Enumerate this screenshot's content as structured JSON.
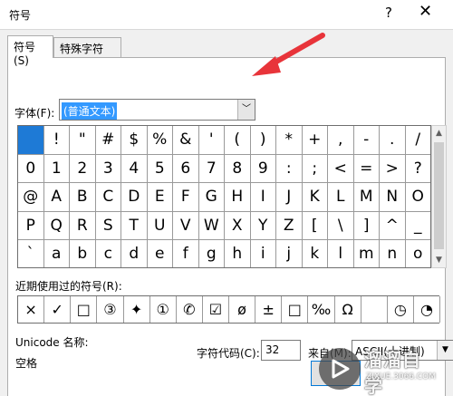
{
  "window": {
    "title": "符号",
    "help": "?",
    "close": "✕"
  },
  "tabs": [
    {
      "label": "符号(S)",
      "active": true
    },
    {
      "label": "特殊字符(P)",
      "active": false
    }
  ],
  "font": {
    "label": "字体(F):",
    "value": "(普通文本)"
  },
  "symbols": {
    "rows": [
      [
        "",
        "!",
        "\"",
        "#",
        "$",
        "%",
        "&",
        "'",
        "(",
        ")",
        "*",
        "+",
        ",",
        "-",
        ".",
        "/"
      ],
      [
        "0",
        "1",
        "2",
        "3",
        "4",
        "5",
        "6",
        "7",
        "8",
        "9",
        ":",
        ";",
        "<",
        "=",
        ">",
        "?"
      ],
      [
        "@",
        "A",
        "B",
        "C",
        "D",
        "E",
        "F",
        "G",
        "H",
        "I",
        "J",
        "K",
        "L",
        "M",
        "N",
        "O"
      ],
      [
        "P",
        "Q",
        "R",
        "S",
        "T",
        "U",
        "V",
        "W",
        "X",
        "Y",
        "Z",
        "[",
        "\\",
        "]",
        "^",
        "_"
      ],
      [
        "`",
        "a",
        "b",
        "c",
        "d",
        "e",
        "f",
        "g",
        "h",
        "i",
        "j",
        "k",
        "l",
        "m",
        "n",
        "o"
      ]
    ],
    "selected": [
      0,
      0
    ]
  },
  "recent": {
    "label": "近期使用过的符号(R):",
    "symbols": [
      "×",
      "✓",
      "□",
      "③",
      "✦",
      "①",
      "✆",
      "☑",
      "ø",
      "±",
      "□",
      "‰",
      "Ω",
      "",
      "◷",
      "◔"
    ]
  },
  "unicode": {
    "label": "Unicode 名称:",
    "value": "空格"
  },
  "char_code": {
    "label": "字符代码(C):",
    "value": "32"
  },
  "from": {
    "label": "来自(M):",
    "value": "ASCII(十进制)"
  },
  "watermark": {
    "cn": "溜溜自学",
    "url": "ZIXUE.3066.COM"
  },
  "colors": {
    "selection": "#1e7ad6",
    "arrow": "#e8343a",
    "highlight": "#3399ff"
  }
}
